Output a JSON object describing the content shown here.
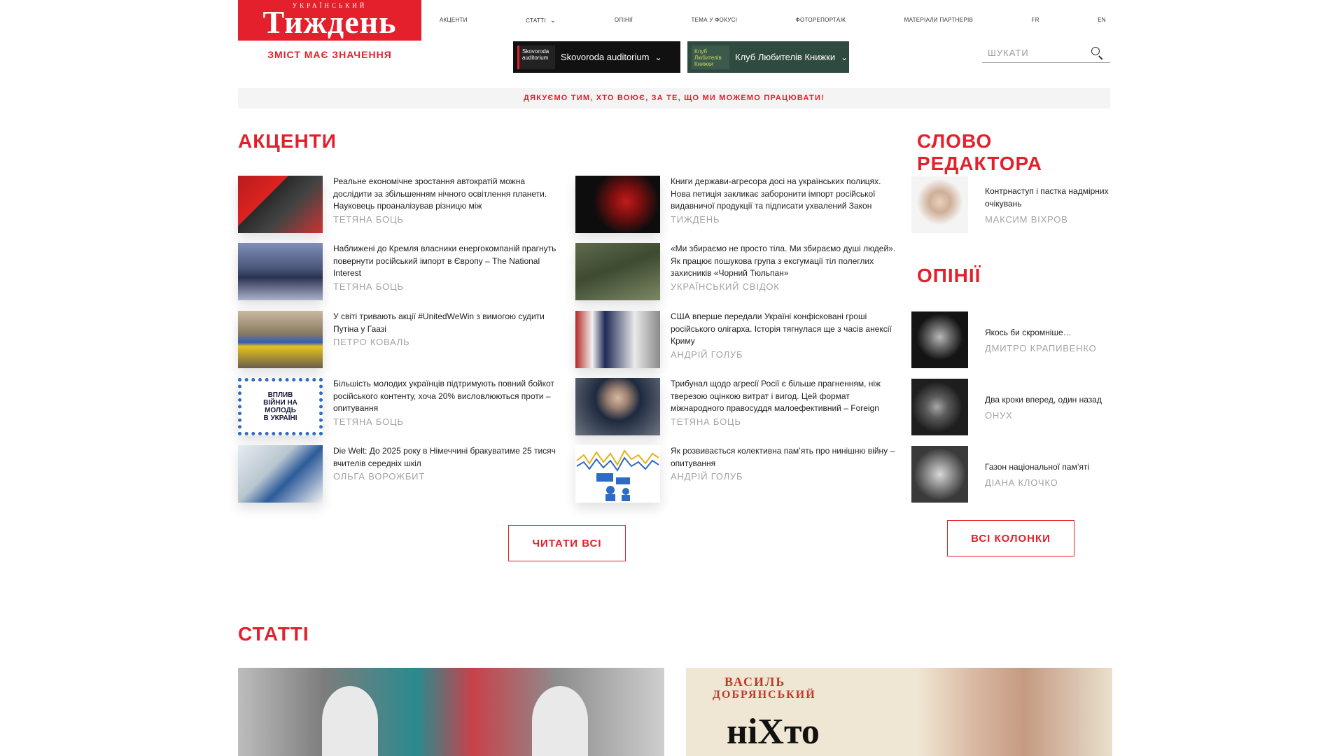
{
  "header": {
    "logo_small": "УКРАЇНСЬКИЙ",
    "logo_big": "Тиждень",
    "tagline": "ЗМІСТ МАЄ ЗНАЧЕННЯ",
    "nav": [
      "АКЦЕНТИ",
      "СТАТТІ",
      "ОПІНІЇ",
      "ТЕМА У ФОКУСІ",
      "ФОТОРЕПОРТАЖ",
      "МАТЕРІАЛИ ПАРТНЕРІВ",
      "FR",
      "EN"
    ],
    "promos": [
      {
        "thumb": "Skovoroda auditorium",
        "label": "Skovoroda auditorium"
      },
      {
        "thumb": "Клуб Любителів Книжки",
        "label": "Клуб Любителів Книжки"
      }
    ],
    "search_placeholder": "ШУКАТИ"
  },
  "banner": "ДЯКУЄМО ТИМ, ХТО ВОЮЄ, ЗА ТЕ, ЩО МИ МОЖЕМО ПРАЦЮВАТИ!",
  "accents": {
    "title": "АКЦЕНТИ",
    "left": [
      {
        "title": "Реальне економічне зростання автократій можна дослідити за збільшенням нічного освітлення планети. Науковець проаналізував різницю між",
        "author": "ТЕТЯНА БОЦЬ"
      },
      {
        "title": "Наближені до Кремля власники енергокомпаній прагнуть повернути російський імпорт в Європу – The National Interest",
        "author": "ТЕТЯНА БОЦЬ"
      },
      {
        "title": "У світі тривають акції #UnitedWeWin з вимогою судити Путіна у Гаазі",
        "author": "ПЕТРО КОВАЛЬ"
      },
      {
        "title": "Більшість молодих українців підтримують повний бойкот російського контенту, хоча 20% висловлюються проти – опитування",
        "author": "ТЕТЯНА БОЦЬ"
      },
      {
        "title": "Die Welt: До 2025 року в Німеччині бракуватиме 25 тисяч вчителів середніх шкіл",
        "author": "ОЛЬГА ВОРОЖБИТ"
      }
    ],
    "right": [
      {
        "title": "Книги держави-агресора досі на українських полицях. Нова петиція закликає заборонити імпорт російської видавничої продукції та підписати ухвалений Закон",
        "author": "ТИЖДЕНЬ"
      },
      {
        "title": "«Ми збираємо не просто тіла. Ми збираємо душі людей». Як працює пошукова група з ексгумації тіл полеглих захисників «Чорний Тюльпан»",
        "author": "УКРАЇНСЬКИЙ СВІДОК"
      },
      {
        "title": "США вперше передали Україні конфісковані гроші російського олігарха. Історія тягнулася ще з часів анексії Криму",
        "author": "АНДРІЙ ГОЛУБ"
      },
      {
        "title": "Трибунал щодо агресії Росії є більше прагненням, ніж тверезою оцінкою витрат і вигод. Цей формат міжнародного правосуддя малоефективний – Foreign",
        "author": "ТЕТЯНА БОЦЬ"
      },
      {
        "title": "Як розвивається колективна пам’ять про нинішню війну – опитування",
        "author": "АНДРІЙ ГОЛУБ"
      }
    ],
    "read_all": "ЧИТАТИ ВСІ"
  },
  "editor": {
    "title": "СЛОВО РЕДАКТОРА",
    "item": {
      "title": "Контрнаступ і пастка надмірних очікувань",
      "author": "МАКСИМ ВІХРОВ"
    }
  },
  "opinions": {
    "title": "ОПІНІЇ",
    "items": [
      {
        "title": "Якось би скромніше…",
        "author": "ДМИТРО КРАПИВЕНКО"
      },
      {
        "title": "Два кроки вперед, один назад",
        "author": "ОНУХ"
      },
      {
        "title": "Газон національної пам’яті",
        "author": "ДІАНА КЛОЧКО"
      }
    ],
    "all_columns": "ВСІ КОЛОНКИ"
  },
  "articles": {
    "title": "СТАТТІ",
    "second_cover_top": "ВАСИЛЬ",
    "second_cover_name": "ДОБРЯНСЬКИЙ",
    "second_cover_word": "ніХто"
  },
  "colors": {
    "accent": "#e3202b",
    "muted": "#a3a3a3"
  }
}
